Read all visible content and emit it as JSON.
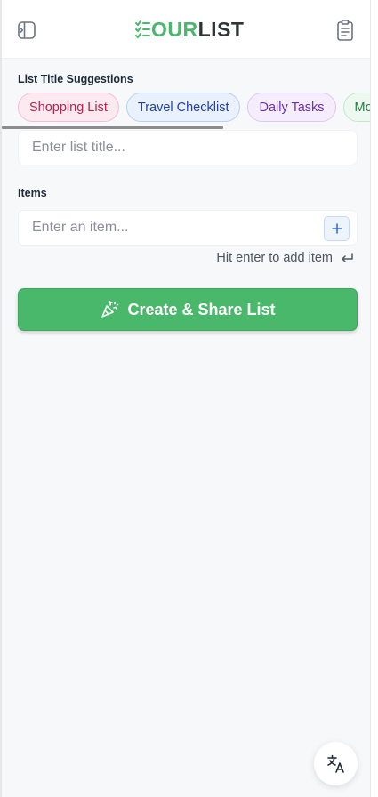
{
  "header": {
    "logo": {
      "part1": "OUR",
      "part2": "LIST"
    },
    "accent_color": "#4ab86c",
    "left_icon": "sidebar-toggle-icon",
    "right_icon": "clipboard-icon"
  },
  "suggestions": {
    "label": "List Title Suggestions",
    "chips": [
      {
        "label": "Shopping List",
        "color": "pink"
      },
      {
        "label": "Travel Checklist",
        "color": "blue"
      },
      {
        "label": "Daily Tasks",
        "color": "purple"
      },
      {
        "label": "Mo",
        "color": "green"
      }
    ]
  },
  "title_input": {
    "placeholder": "Enter list title...",
    "value": ""
  },
  "items": {
    "label": "Items",
    "input": {
      "placeholder": "Enter an item...",
      "value": ""
    },
    "add_icon": "plus-icon",
    "hint": "Hit enter to add item",
    "hint_icon": "return-icon"
  },
  "cta": {
    "label": "Create & Share List",
    "icon": "party-popper-icon",
    "color": "#49b86b"
  },
  "translate": {
    "icon": "translate-icon"
  }
}
